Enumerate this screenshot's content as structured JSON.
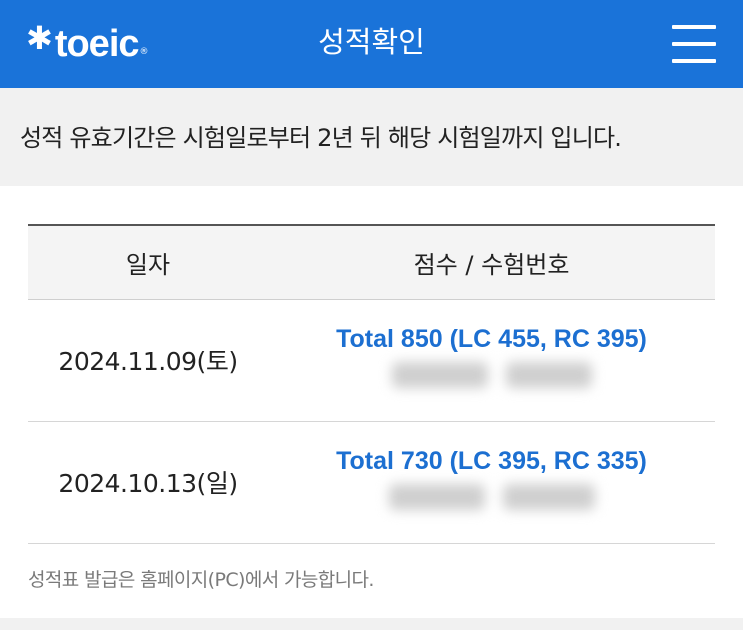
{
  "header": {
    "logo_star": "✱",
    "logo_text": "toeic",
    "logo_mark": "®",
    "title": "성적확인",
    "menu_icon": "hamburger-menu-icon",
    "background_color": "#1a73d9"
  },
  "notice": {
    "text": "성적 유효기간은 시험일로부터 2년 뒤 해당 시험일까지 입니다."
  },
  "table": {
    "headers": [
      "일자",
      "점수 / 수험번호"
    ],
    "rows": [
      {
        "date": "2024.11.09(토)",
        "score": "Total 850 (LC 455, RC 395)",
        "exam_number_blurred": true
      },
      {
        "date": "2024.10.13(일)",
        "score": "Total 730 (LC 395, RC 335)",
        "exam_number_blurred": true
      }
    ],
    "score_link_color": "#1c6fd1"
  },
  "footnote": "성적표 발급은 홈페이지(PC)에서 가능합니다."
}
